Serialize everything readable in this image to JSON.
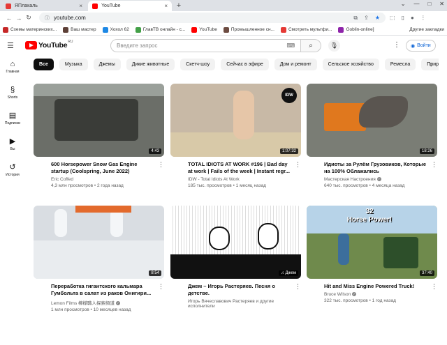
{
  "browser": {
    "tabs": [
      {
        "label": "ЯПлакаль",
        "color": "#e53935"
      },
      {
        "label": "YouTube",
        "color": "#ff0000"
      }
    ],
    "url": "youtube.com",
    "bookmarks": [
      {
        "label": "Схемы материнских...",
        "color": "#c62828"
      },
      {
        "label": "Ваш мастер",
        "color": "#5d4037"
      },
      {
        "label": "Хохол 62",
        "color": "#1e88e5"
      },
      {
        "label": "ГлавТВ онлайн - с...",
        "color": "#43a047"
      },
      {
        "label": "YouTube",
        "color": "#ff0000"
      },
      {
        "label": "Промышленное сн...",
        "color": "#6d4c41"
      },
      {
        "label": "Смотреть мультфи...",
        "color": "#e53935"
      },
      {
        "label": "Goblin-online]",
        "color": "#8e24aa"
      }
    ],
    "other_bookmarks": "Другие закладки"
  },
  "masthead": {
    "logo_text": "YouTube",
    "logo_region": "RU",
    "search_placeholder": "Введите запрос",
    "login_label": "Войти"
  },
  "sidebar": [
    {
      "label": "Главная",
      "icon": "home-icon",
      "glyph": "⌂"
    },
    {
      "label": "Shorts",
      "icon": "shorts-icon",
      "glyph": "§"
    },
    {
      "label": "Подписки",
      "icon": "subscriptions-icon",
      "glyph": "▤"
    },
    {
      "label": "Вы",
      "icon": "library-icon",
      "glyph": "▶"
    },
    {
      "label": "История",
      "icon": "history-icon",
      "glyph": "↺"
    }
  ],
  "chips": [
    "Все",
    "Музыка",
    "Джемы",
    "Дикие животные",
    "Скетч-шоу",
    "Сейчас в эфире",
    "Дом и ремонт",
    "Сельское хозяйство",
    "Ремесла",
    "Природа"
  ],
  "videos": [
    {
      "title": "600 Horsepower Snow Gas Engine startup (Coolspring, June 2022)",
      "channel": "Eric Coffed",
      "verified": false,
      "views": "4,3 млн просмотров",
      "age": "2 года назад",
      "duration": "4:43",
      "bg": "#6b6e68",
      "accent": "#3a3c38"
    },
    {
      "title": "TOTAL IDIOTS AT WORK #196 | Bad day at work | Fails of the week | Instant regr...",
      "channel": "IDW - Total Idiots At Work",
      "verified": false,
      "views": "185 тыс. просмотров",
      "age": "1 месяц назад",
      "duration": "1:07:32",
      "bg": "#c8b9a6",
      "accent": "#8d7a63"
    },
    {
      "title": "Идиоты за Рулём Грузовиков, Которые на 100% Облажались",
      "channel": "Мастерская Настроения",
      "verified": true,
      "views": "640 тыс. просмотров",
      "age": "4 месяца назад",
      "duration": "18:26",
      "bg": "#7a7d75",
      "accent": "#e0781e"
    },
    {
      "title": "Переработка гигантского кальмара Гумбольта в салат из раков Онигири...",
      "channel": "Lemon Films 檸檬職人探索頻道",
      "verified": true,
      "views": "1 млн просмотров",
      "age": "10 месяцев назад",
      "duration": "8:54",
      "bg": "#d9dde2",
      "accent": "#e36a2c"
    },
    {
      "title": "Джем – Игорь Растеряев. Песня о детстве.",
      "channel": "Игорь Вячеславович Растеряев и другие исполнители",
      "verified": false,
      "views": "",
      "age": "",
      "duration": "Джем",
      "bg": "#efefef",
      "accent": "#111111"
    },
    {
      "title": "Hit and Miss Engine Powered Truck!",
      "channel": "Bruce Wilson",
      "verified": true,
      "views": "322 тыс. просмотров",
      "age": "1 год назад",
      "duration": "37:40",
      "bg": "#6f8a4c",
      "accent": "#3c6e9c"
    }
  ],
  "thumb_captions": {
    "idw_badge": "IDW",
    "horse_power": "32\nHorse Power!"
  }
}
